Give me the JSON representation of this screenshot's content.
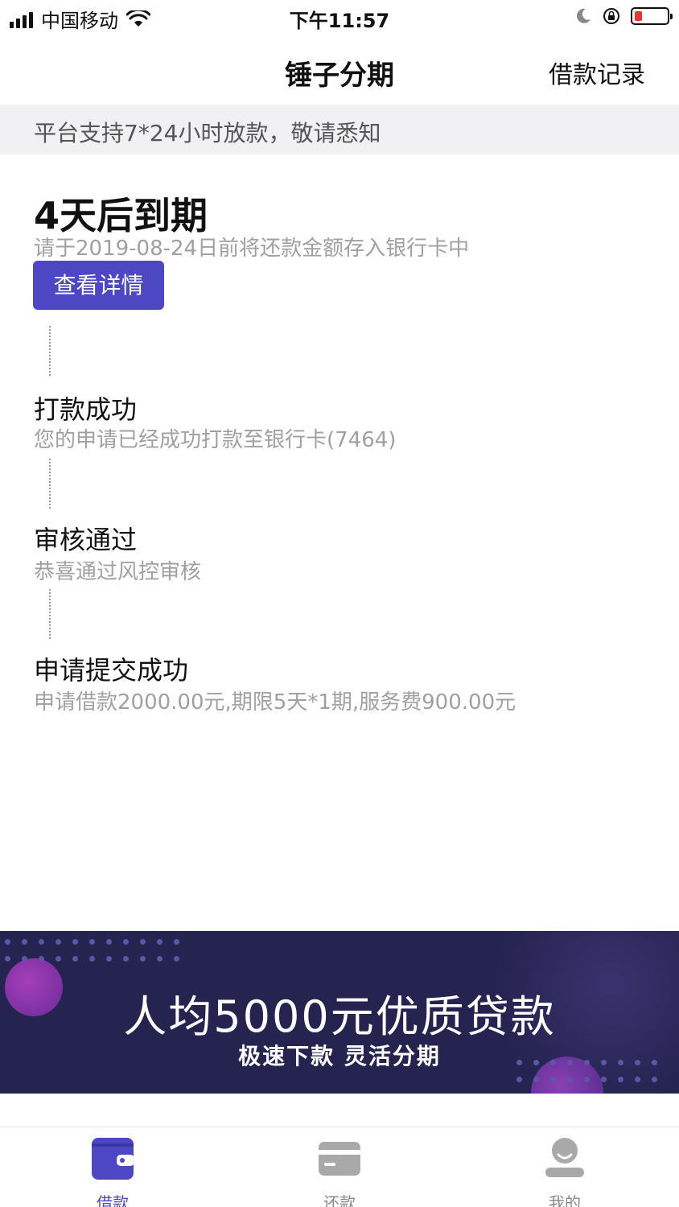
{
  "status_bar": {
    "carrier": "中国移动",
    "time": "下午11:57"
  },
  "nav": {
    "title": "锤子分期",
    "right_action": "借款记录"
  },
  "notice": "平台支持7*24小时放款，敬请悉知",
  "due": {
    "title": "4天后到期",
    "subtitle": "请于2019-08-24日前将还款金额存入银行卡中",
    "button": "查看详情"
  },
  "steps": [
    {
      "title": "打款成功",
      "subtitle": "您的申请已经成功打款至银行卡(7464)"
    },
    {
      "title": "审核通过",
      "subtitle": "恭喜通过风控审核"
    },
    {
      "title": "申请提交成功",
      "subtitle": "申请借款2000.00元,期限5天*1期,服务费900.00元"
    }
  ],
  "banner": {
    "title": "人均5000元优质贷款",
    "subtitle": "极速下款 灵活分期"
  },
  "tabs": [
    {
      "label": "借款",
      "icon": "wallet-icon",
      "active": true
    },
    {
      "label": "还款",
      "icon": "card-icon",
      "active": false
    },
    {
      "label": "我的",
      "icon": "user-icon",
      "active": false
    }
  ],
  "colors": {
    "accent": "#4d47c3",
    "banner_bg": "#25234f",
    "notice_bg": "#f1f1f4",
    "battery_low": "#e33333"
  }
}
